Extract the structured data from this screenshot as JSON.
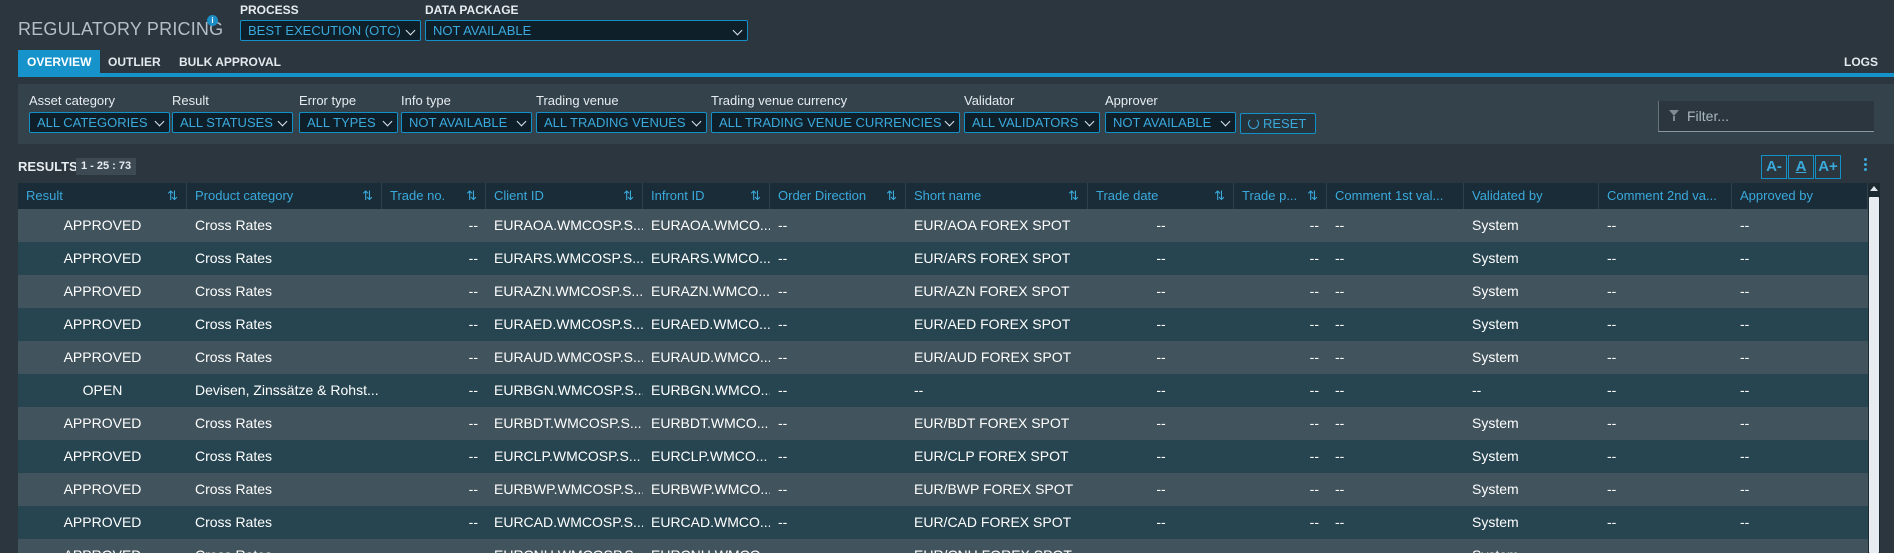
{
  "app": {
    "title": "REGULATORY PRICING",
    "info_icon": "i"
  },
  "process": {
    "label": "PROCESS",
    "value": "BEST EXECUTION (OTC)"
  },
  "data_package": {
    "label": "DATA PACKAGE",
    "value": "NOT AVAILABLE"
  },
  "tabs": [
    {
      "label": "OVERVIEW",
      "active": true
    },
    {
      "label": "OUTLIER",
      "active": false
    },
    {
      "label": "BULK APPROVAL",
      "active": false
    },
    {
      "label": "LOGS",
      "active": false
    }
  ],
  "filters": [
    {
      "label": "Asset category",
      "value": "ALL CATEGORIES"
    },
    {
      "label": "Result",
      "value": "ALL STATUSES"
    },
    {
      "label": "Error type",
      "value": "ALL TYPES"
    },
    {
      "label": "Info type",
      "value": "NOT AVAILABLE"
    },
    {
      "label": "Trading venue",
      "value": "ALL TRADING VENUES"
    },
    {
      "label": "Trading venue currency",
      "value": "ALL TRADING VENUE CURRENCIES"
    },
    {
      "label": "Validator",
      "value": "ALL VALIDATORS"
    },
    {
      "label": "Approver",
      "value": "NOT AVAILABLE"
    }
  ],
  "reset_label": "RESET",
  "filter_placeholder": "Filter...",
  "results": {
    "label": "RESULTS",
    "count": "1 - 25 : 73"
  },
  "font_controls": {
    "decrease": "A-",
    "default": "A",
    "increase": "A+"
  },
  "columns": [
    "Result",
    "Product category",
    "Trade no.",
    "Client ID",
    "Infront ID",
    "Order Direction",
    "Short name",
    "Trade date",
    "Trade p...",
    "Comment 1st val...",
    "Validated by",
    "Comment 2nd va...",
    "Approved by"
  ],
  "sort_icon": "⇅",
  "rows": [
    [
      "APPROVED",
      "Cross Rates",
      "--",
      "EURAOA.WMCOSP.S...",
      "EURAOA.WMCO...",
      "--",
      "EUR/AOA FOREX SPOT",
      "--",
      "--",
      "--",
      "System",
      "--",
      "--"
    ],
    [
      "APPROVED",
      "Cross Rates",
      "--",
      "EURARS.WMCOSP.S...",
      "EURARS.WMCO...",
      "--",
      "EUR/ARS FOREX SPOT",
      "--",
      "--",
      "--",
      "System",
      "--",
      "--"
    ],
    [
      "APPROVED",
      "Cross Rates",
      "--",
      "EURAZN.WMCOSP.S...",
      "EURAZN.WMCO...",
      "--",
      "EUR/AZN FOREX SPOT",
      "--",
      "--",
      "--",
      "System",
      "--",
      "--"
    ],
    [
      "APPROVED",
      "Cross Rates",
      "--",
      "EURAED.WMCOSP.S...",
      "EURAED.WMCO...",
      "--",
      "EUR/AED FOREX SPOT",
      "--",
      "--",
      "--",
      "System",
      "--",
      "--"
    ],
    [
      "APPROVED",
      "Cross Rates",
      "--",
      "EURAUD.WMCOSP.S...",
      "EURAUD.WMCO...",
      "--",
      "EUR/AUD FOREX SPOT",
      "--",
      "--",
      "--",
      "System",
      "--",
      "--"
    ],
    [
      "OPEN",
      "Devisen, Zinssätze & Rohst...",
      "--",
      "EURBGN.WMCOSP.S...",
      "EURBGN.WMCO...",
      "--",
      "--",
      "--",
      "--",
      "--",
      "--",
      "--",
      "--"
    ],
    [
      "APPROVED",
      "Cross Rates",
      "--",
      "EURBDT.WMCOSP.S...",
      "EURBDT.WMCO...",
      "--",
      "EUR/BDT FOREX SPOT",
      "--",
      "--",
      "--",
      "System",
      "--",
      "--"
    ],
    [
      "APPROVED",
      "Cross Rates",
      "--",
      "EURCLP.WMCOSP.S...",
      "EURCLP.WMCO...",
      "--",
      "EUR/CLP FOREX SPOT",
      "--",
      "--",
      "--",
      "System",
      "--",
      "--"
    ],
    [
      "APPROVED",
      "Cross Rates",
      "--",
      "EURBWP.WMCOSP.S...",
      "EURBWP.WMCO...",
      "--",
      "EUR/BWP FOREX SPOT",
      "--",
      "--",
      "--",
      "System",
      "--",
      "--"
    ],
    [
      "APPROVED",
      "Cross Rates",
      "--",
      "EURCAD.WMCOSP.S...",
      "EURCAD.WMCO...",
      "--",
      "EUR/CAD FOREX SPOT",
      "--",
      "--",
      "--",
      "System",
      "--",
      "--"
    ],
    [
      "APPROVED",
      "Cross Rates",
      "--",
      "EURCNH.WMCOSP.S...",
      "EURCNH.WMCO...",
      "--",
      "EUR/CNH FOREX SPOT",
      "--",
      "--",
      "--",
      "System",
      "--",
      "--"
    ]
  ]
}
